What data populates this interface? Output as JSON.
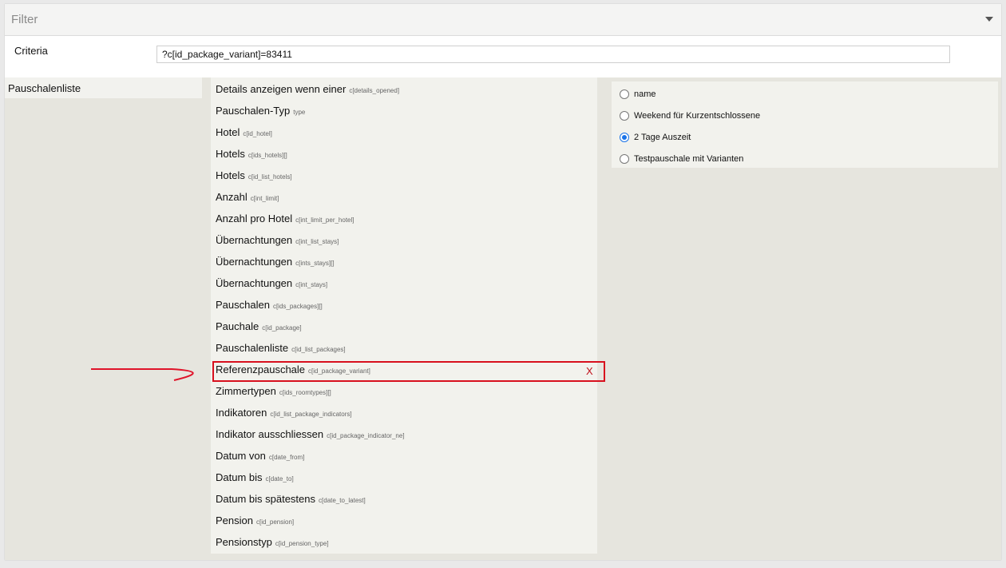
{
  "filter": {
    "title": "Filter"
  },
  "criteria": {
    "label": "Criteria",
    "value": "?c[id_package_variant]=83411"
  },
  "left_list": {
    "items": [
      {
        "label": "Pauschalenliste"
      }
    ]
  },
  "fields": [
    {
      "label": "Details anzeigen wenn einer",
      "key": "c[details_opened]"
    },
    {
      "label": "Pauschalen-Typ",
      "key": "type"
    },
    {
      "label": "Hotel",
      "key": "c[id_hotel]"
    },
    {
      "label": "Hotels",
      "key": "c[ids_hotels][]"
    },
    {
      "label": "Hotels",
      "key": "c[id_list_hotels]"
    },
    {
      "label": "Anzahl",
      "key": "c[int_limit]"
    },
    {
      "label": "Anzahl pro Hotel",
      "key": "c[int_limit_per_hotel]"
    },
    {
      "label": "Übernachtungen",
      "key": "c[int_list_stays]"
    },
    {
      "label": "Übernachtungen",
      "key": "c[ints_stays][]"
    },
    {
      "label": "Übernachtungen",
      "key": "c[int_stays]"
    },
    {
      "label": "Pauschalen",
      "key": "c[ids_packages][]"
    },
    {
      "label": "Pauchale",
      "key": "c[id_package]"
    },
    {
      "label": "Pauschalenliste",
      "key": "c[id_list_packages]"
    },
    {
      "label": "Referenzpauschale",
      "key": "c[id_package_variant]",
      "remove": "X"
    },
    {
      "label": "Zimmertypen",
      "key": "c[ids_roomtypes][]"
    },
    {
      "label": "Indikatoren",
      "key": "c[id_list_package_indicators]"
    },
    {
      "label": "Indikator ausschliessen",
      "key": "c[id_package_indicator_ne]"
    },
    {
      "label": "Datum von",
      "key": "c[date_from]"
    },
    {
      "label": "Datum bis",
      "key": "c[date_to]"
    },
    {
      "label": "Datum bis spätestens",
      "key": "c[date_to_latest]"
    },
    {
      "label": "Pension",
      "key": "c[id_pension]"
    },
    {
      "label": "Pensionstyp",
      "key": "c[id_pension_type]"
    }
  ],
  "options": [
    {
      "label": "name",
      "checked": false
    },
    {
      "label": "Weekend für Kurzentschlossene",
      "checked": false
    },
    {
      "label": "2 Tage Auszeit",
      "checked": true
    },
    {
      "label": "Testpauschale mit Varianten",
      "checked": false
    }
  ],
  "colors": {
    "highlight": "#d8101e",
    "radio_accent": "#1a73e8"
  }
}
